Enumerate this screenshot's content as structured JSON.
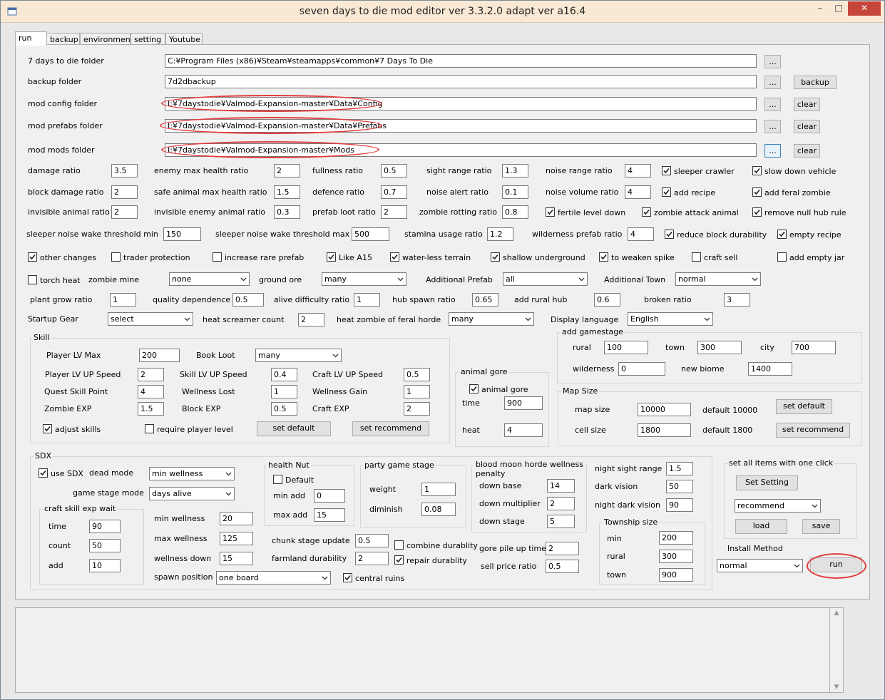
{
  "window": {
    "title": "seven days to die mod editor ver 3.3.2.0 adapt ver a16.4",
    "minimize": "–",
    "maximize": "□",
    "close": "✕"
  },
  "tabs": [
    "run",
    "backup",
    "environment",
    "setting",
    "Youtube"
  ],
  "folders": {
    "seven_days_label": "7 days to die folder",
    "seven_days_value": "C:¥Program Files (x86)¥Steam¥steamapps¥common¥7 Days To Die",
    "backup_label": "backup folder",
    "backup_value": "7d2dbackup",
    "backup_button": "backup",
    "config_label": "mod config folder",
    "config_value": "I:¥7daystodie¥Valmod-Expansion-master¥Data¥Config",
    "prefabs_label": "mod prefabs folder",
    "prefabs_value": "I:¥7daystodie¥Valmod-Expansion-master¥Data¥Prefabs",
    "mods_label": "mod mods folder",
    "mods_value": "I:¥7daystodie¥Valmod-Expansion-master¥Mods",
    "browse": "...",
    "clear": "clear"
  },
  "ratios": {
    "damage_ratio": {
      "label": "damage ratio",
      "value": "3.5"
    },
    "enemy_max_health_ratio": {
      "label": "enemy max health ratio",
      "value": "2"
    },
    "fullness_ratio": {
      "label": "fullness ratio",
      "value": "0.5"
    },
    "sight_range_ratio": {
      "label": "sight range ratio",
      "value": "1.3"
    },
    "noise_range_ratio": {
      "label": "noise range ratio",
      "value": "4"
    },
    "block_damage_ratio": {
      "label": "block damage ratio",
      "value": "2"
    },
    "safe_animal_max_health_ratio": {
      "label": "safe animal max health ratio",
      "value": "1.5"
    },
    "defence_ratio": {
      "label": "defence ratio",
      "value": "0.7"
    },
    "noise_alert_ratio": {
      "label": "noise alert ratio",
      "value": "0.1"
    },
    "noise_volume_ratio": {
      "label": "noise volume ratio",
      "value": "4"
    },
    "invisible_animal_ratio": {
      "label": "invisible animal ratio",
      "value": "2"
    },
    "invisible_enemy_animal_ratio": {
      "label": "invisible enemy animal ratio",
      "value": "0.3"
    },
    "prefab_loot_ratio": {
      "label": "prefab loot ratio",
      "value": "2"
    },
    "zombie_rotting_ratio": {
      "label": "zombie rotting ratio",
      "value": "0.8"
    },
    "sleeper_noise_min": {
      "label": "sleeper noise wake threshold min",
      "value": "150"
    },
    "sleeper_noise_max": {
      "label": "sleeper noise wake threshold max",
      "value": "500"
    },
    "stamina_usage_ratio": {
      "label": "stamina usage ratio",
      "value": "1.2"
    },
    "wilderness_prefab_ratio": {
      "label": "wilderness prefab ratio",
      "value": "4"
    }
  },
  "checks": {
    "sleeper_crawler": {
      "label": "sleeper crawler",
      "checked": true
    },
    "slow_down_vehicle": {
      "label": "slow down vehicle",
      "checked": true
    },
    "add_recipe": {
      "label": "add recipe",
      "checked": true
    },
    "add_feral_zombie": {
      "label": "add feral zombie",
      "checked": true
    },
    "fertile_level_down": {
      "label": "fertile level down",
      "checked": true
    },
    "zombie_attack_animal": {
      "label": "zombie attack animal",
      "checked": true
    },
    "remove_null_hub_rule": {
      "label": "remove null hub rule",
      "checked": true
    },
    "reduce_block_durability": {
      "label": "reduce block durability",
      "checked": true
    },
    "empty_recipe": {
      "label": "empty recipe",
      "checked": true
    },
    "other_changes": {
      "label": "other changes",
      "checked": true
    },
    "trader_protection": {
      "label": "trader protection",
      "checked": false
    },
    "increase_rare_prefab": {
      "label": "increase rare prefab",
      "checked": false
    },
    "like_a15": {
      "label": "Like A15",
      "checked": true
    },
    "water_less_terrain": {
      "label": "water-less terrain",
      "checked": true
    },
    "shallow_underground": {
      "label": "shallow underground",
      "checked": true
    },
    "to_weaken_spike": {
      "label": "to weaken spike",
      "checked": true
    },
    "craft_sell": {
      "label": "craft sell",
      "checked": false
    },
    "add_empty_jar": {
      "label": "add empty jar",
      "checked": false
    },
    "torch_heat": {
      "label": "torch heat",
      "checked": false
    }
  },
  "row_misc": {
    "zombie_mine": {
      "label": "zombie mine",
      "value": "none"
    },
    "ground_ore": {
      "label": "ground ore",
      "value": "many"
    },
    "additional_prefab": {
      "label": "Additional Prefab",
      "value": "all"
    },
    "additional_town": {
      "label": "Additional Town",
      "value": "normal"
    },
    "plant_grow_ratio": {
      "label": "plant grow ratio",
      "value": "1"
    },
    "quality_dependence": {
      "label": "quality dependence",
      "value": "0.5"
    },
    "alive_difficulty_ratio": {
      "label": "alive difficulty ratio",
      "value": "1"
    },
    "hub_spawn_ratio": {
      "label": "hub spawn ratio",
      "value": "0.65"
    },
    "add_rural_hub": {
      "label": "add rural hub",
      "value": "0.6"
    },
    "broken_ratio": {
      "label": "broken ratio",
      "value": "3"
    },
    "startup_gear": {
      "label": "Startup Gear",
      "value": "select"
    },
    "heat_screamer_count": {
      "label": "heat screamer count",
      "value": "2"
    },
    "heat_zombie_feral": {
      "label": "heat zombie of feral horde",
      "value": "many"
    },
    "display_language": {
      "label": "Display language",
      "value": "English"
    }
  },
  "skill": {
    "title": "Skill",
    "player_lv_max": {
      "label": "Player LV Max",
      "value": "200"
    },
    "book_loot": {
      "label": "Book Loot",
      "value": "many"
    },
    "player_lv_up_speed": {
      "label": "Player LV UP Speed",
      "value": "2"
    },
    "skill_lv_up_speed": {
      "label": "Skill LV UP Speed",
      "value": "0.4"
    },
    "craft_lv_up_speed": {
      "label": "Craft LV UP Speed",
      "value": "0.5"
    },
    "quest_skill_point": {
      "label": "Quest Skill Point",
      "value": "4"
    },
    "wellness_lost": {
      "label": "Wellness Lost",
      "value": "1"
    },
    "wellness_gain": {
      "label": "Wellness Gain",
      "value": "1"
    },
    "zombie_exp": {
      "label": "Zombie EXP",
      "value": "1.5"
    },
    "block_exp": {
      "label": "Block EXP",
      "value": "0.5"
    },
    "craft_exp": {
      "label": "Craft EXP",
      "value": "2"
    },
    "adjust_skills": {
      "label": "adjust skills",
      "checked": true
    },
    "require_player_level": {
      "label": "require player level",
      "checked": false
    },
    "set_default": "set default",
    "set_recommend": "set recommend"
  },
  "animal_gore": {
    "title": "animal gore",
    "check_label": "animal gore",
    "checked": true,
    "time_label": "time",
    "time_value": "900",
    "heat_label": "heat",
    "heat_value": "4"
  },
  "gamestage": {
    "title": "add gamestage",
    "rural_label": "rural",
    "rural_value": "100",
    "town_label": "town",
    "town_value": "300",
    "city_label": "city",
    "city_value": "700",
    "wilderness_label": "wilderness",
    "wilderness_value": "0",
    "new_biome_label": "new biome",
    "new_biome_value": "1400"
  },
  "map_size": {
    "title": "Map Size",
    "map_size_label": "map size",
    "map_size_value": "10000",
    "default_map": "default 10000",
    "set_default": "set default",
    "cell_size_label": "cell size",
    "cell_size_value": "1800",
    "default_cell": "default 1800",
    "set_recommend": "set recommend"
  },
  "sdx": {
    "title": "SDX",
    "use_sdx": {
      "label": "use SDX",
      "checked": true
    },
    "dead_mode_label": "dead mode",
    "dead_mode_value": "min wellness",
    "game_stage_mode_label": "game stage mode",
    "game_stage_mode_value": "days alive",
    "craft_title": "craft skill exp wait",
    "time_label": "time",
    "time_value": "90",
    "count_label": "count",
    "count_value": "50",
    "add_label": "add",
    "add_value": "10",
    "min_wellness_label": "min wellness",
    "min_wellness_value": "20",
    "max_wellness_label": "max wellness",
    "max_wellness_value": "125",
    "wellness_down_label": "wellness down",
    "wellness_down_value": "15",
    "spawn_position_label": "spawn position",
    "spawn_position_value": "one board",
    "health_nut_title": "health Nut",
    "default_label": "Default",
    "default_checked": false,
    "min_add_label": "min add",
    "min_add_value": "0",
    "max_add_label": "max add",
    "max_add_value": "15",
    "party_title": "party game stage",
    "weight_label": "weight",
    "weight_value": "1",
    "diminish_label": "diminish",
    "diminish_value": "0.08",
    "chunk_label": "chunk stage update",
    "chunk_value": "0.5",
    "farmland_label": "farmland durability",
    "farmland_value": "2",
    "combine_durablity": {
      "label": "combine durablity",
      "checked": false
    },
    "repair_durablity": {
      "label": "repair durablity",
      "checked": true
    },
    "central_ruins": {
      "label": "central ruins",
      "checked": true
    },
    "blood_title_1": "blood moon horde wellness",
    "blood_title_2": "penalty",
    "down_base_label": "down base",
    "down_base_value": "14",
    "down_multiplier_label": "down multiplier",
    "down_multiplier_value": "2",
    "down_stage_label": "down stage",
    "down_stage_value": "5",
    "gore_pile_label": "gore pile up time",
    "gore_pile_value": "2",
    "sell_price_label": "sell price ratio",
    "sell_price_value": "0.5",
    "night_sight_label": "night sight range",
    "night_sight_value": "1.5",
    "dark_vision_label": "dark vision",
    "dark_vision_value": "50",
    "night_dark_label": "night dark vision",
    "night_dark_value": "90",
    "township_title": "Township size",
    "t_min_label": "min",
    "t_min_value": "200",
    "t_rural_label": "rural",
    "t_rural_value": "300",
    "t_town_label": "town",
    "t_town_value": "900"
  },
  "set_all": {
    "title": "set all items with one click",
    "set_setting": "Set Setting",
    "preset_value": "recommend",
    "load": "load",
    "save": "save"
  },
  "install": {
    "label": "Install Method",
    "value": "normal",
    "run": "run"
  },
  "colors": {
    "highlight": "#e23b3b",
    "titlebar": "#f9e9d4",
    "close": "#c7463b"
  }
}
